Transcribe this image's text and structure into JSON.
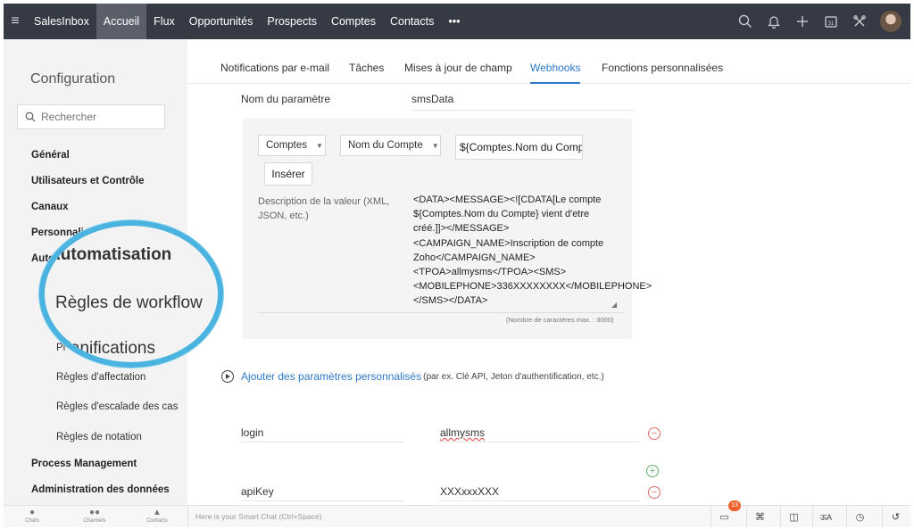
{
  "topbar": {
    "menu_icon": "hamburger-icon",
    "brand": "SalesInbox",
    "nav": [
      "Accueil",
      "Flux",
      "Opportunités",
      "Prospects",
      "Comptes",
      "Contacts",
      "•••"
    ],
    "active_nav": "Accueil",
    "right_icons": [
      "search-icon",
      "bell-icon",
      "plus-icon",
      "calendar-icon",
      "tools-icon",
      "avatar"
    ],
    "calendar_day": "31",
    "colors": {
      "bar": "#363a45",
      "active": "#5a5f6b"
    }
  },
  "sidebar": {
    "title": "Configuration",
    "search_placeholder": "Rechercher",
    "items": [
      "Général",
      "Utilisateurs et Contrôle",
      "Canaux",
      "Personnalisation",
      "Automatisation"
    ],
    "sub_items": [
      "Règles d'affectation",
      "Règles d'escalade des cas",
      "Règles de notation"
    ],
    "bottom_items": [
      "Process Management",
      "Administration des données"
    ],
    "magnifier": {
      "heading": "Automatisation",
      "item1": "Règles de workflow",
      "item2": "Planifications"
    },
    "partial_labels": {
      "personnalisation": "Personnalisa",
      "automatisation": "Auto",
      "planifications": "Pl"
    },
    "colors": {
      "bg": "#f3f3f4",
      "magnifier_border": "#4bb3e0"
    }
  },
  "tabs": {
    "items": [
      "Notifications par e-mail",
      "Tâches",
      "Mises à jour de champ",
      "Webhooks",
      "Fonctions personnalisées"
    ],
    "active": "Webhooks",
    "accent": "#2e79c7"
  },
  "form": {
    "param_name_label": "Nom du paramètre",
    "param_name_value": "smsData",
    "module_select": "Comptes",
    "field_select": "Nom du Compte",
    "merge_field": "${Comptes.Nom du Compt",
    "insert_button": "Insérer",
    "description_label": "Description de la valeur (XML, JSON, etc.)",
    "description_value": "<DATA><MESSAGE><![CDATA[Le compte ${Comptes.Nom du Compte} vient d'etre créé.]]></MESSAGE><CAMPAIGN_NAME>Inscription de compte Zoho</CAMPAIGN_NAME><TPOA>allmysms</TPOA><SMS><MOBILEPHONE>336XXXXXXXX</MOBILEPHONE></SMS></DATA>",
    "max_chars": "(Nombre de caractères max. : 3000)",
    "add_custom_link": "Ajouter des paramètres personnalisés",
    "add_custom_hint": "(par ex. Clé API, Jeton d'authentification, etc.)",
    "custom_params": [
      {
        "key": "login",
        "value": "allmysms"
      },
      {
        "key": "apiKey",
        "value": "XXXxxxXXX"
      }
    ]
  },
  "bottombar": {
    "left_items": [
      {
        "icon": "chat-icon",
        "label": "Chats"
      },
      {
        "icon": "channels-icon",
        "label": "Channels"
      },
      {
        "icon": "contacts-icon",
        "label": "Contacts"
      }
    ],
    "smart_chat_placeholder": "Here is your Smart Chat (Ctrl+Space)",
    "notification_count": "13",
    "right_icons": [
      "screen-icon",
      "gamepad-icon",
      "mug-icon",
      "translate-icon",
      "alarm-icon",
      "history-icon"
    ],
    "translate_glyph": "ऊA"
  }
}
